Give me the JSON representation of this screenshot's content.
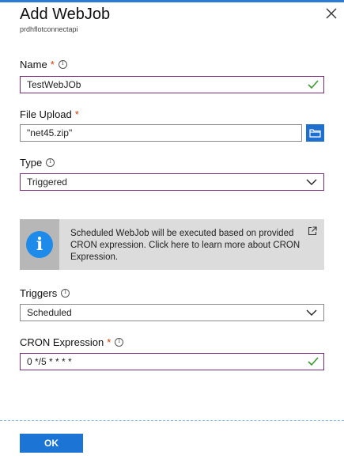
{
  "header": {
    "title": "Add WebJob",
    "subtitle": "prdhflotconnectapi"
  },
  "fields": {
    "name": {
      "label": "Name",
      "value": "TestWebJOb"
    },
    "file_upload": {
      "label": "File Upload",
      "value": "\"net45.zip\""
    },
    "type": {
      "label": "Type",
      "value": "Triggered"
    },
    "triggers": {
      "label": "Triggers",
      "value": "Scheduled"
    },
    "cron": {
      "label": "CRON Expression",
      "value": "0 */5 * * * *"
    }
  },
  "info_banner": {
    "text": "Scheduled WebJob will be executed based on provided CRON expression. Click here to learn more about CRON Expression."
  },
  "actions": {
    "ok_label": "OK"
  },
  "colors": {
    "accent": "#1c74d4",
    "invalid_border": "#7a2c7a",
    "required_marker": "#d83b01",
    "valid_check": "#3a9b2e"
  },
  "icons": [
    "close-icon",
    "info-icon",
    "check-icon",
    "folder-icon",
    "chevron-down-icon",
    "external-link-icon"
  ]
}
